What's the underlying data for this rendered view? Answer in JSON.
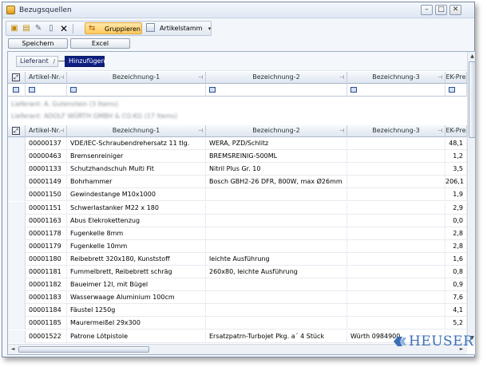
{
  "window": {
    "title": "Bezugsquellen",
    "controls": {
      "minimize": "–",
      "maximize": "□",
      "close": "✕"
    }
  },
  "toolbar": {
    "group_label": "Gruppieren",
    "article_label": "Artikelstamm",
    "overflow": "▾"
  },
  "buttons": {
    "save": "Speichern",
    "excel": "Excel"
  },
  "group_panel": {
    "chip": "Lieferant",
    "sort_glyph": "/",
    "add": "Hinzufügen"
  },
  "columns": [
    "Artikel-Nr.",
    "Bezeichnung-1",
    "Bezeichnung-2",
    "Bezeichnung-3",
    "EK-Pre"
  ],
  "filter_symbol": "▫",
  "groups": [
    "Lieferant: A. Gutenstein (3 Items)",
    "Lieferant: ADOLF WÜRTH GMBH & CO.KG (17 Items)"
  ],
  "rows": [
    {
      "nr": "00000137",
      "b1": "VDE/IEC-Schraubendrehersatz 11 tlg.",
      "b2": "WERA, PZD/Schlitz",
      "b3": "",
      "ek": "48,1"
    },
    {
      "nr": "00000463",
      "b1": "Bremsenreiniger",
      "b2": "BREMSREINIG-500ML",
      "b3": "",
      "ek": "1,2"
    },
    {
      "nr": "00001133",
      "b1": "Schutzhandschuh Multi Fit",
      "b2": "Nitril Plus Gr. 10",
      "b3": "",
      "ek": "3,5"
    },
    {
      "nr": "00001149",
      "b1": "Bohrhammer",
      "b2": "Bosch GBH2-26 DFR, 800W, max Ø26mm",
      "b3": "",
      "ek": "206,1"
    },
    {
      "nr": "00001150",
      "b1": "Gewindestange M10x1000",
      "b2": "",
      "b3": "",
      "ek": "1,9"
    },
    {
      "nr": "00001151",
      "b1": "Schwerlastanker M22 x 180",
      "b2": "",
      "b3": "",
      "ek": "2,9"
    },
    {
      "nr": "00001163",
      "b1": "Abus Elekrokettenzug",
      "b2": "",
      "b3": "",
      "ek": "0,0"
    },
    {
      "nr": "00001178",
      "b1": "Fugenkelle 8mm",
      "b2": "",
      "b3": "",
      "ek": "2,8"
    },
    {
      "nr": "00001179",
      "b1": "Fugenkelle 10mm",
      "b2": "",
      "b3": "",
      "ek": "2,8"
    },
    {
      "nr": "00001180",
      "b1": "Reibebrett 320x180, Kunststoff",
      "b2": "leichte Ausführung",
      "b3": "",
      "ek": "1,6"
    },
    {
      "nr": "00001181",
      "b1": "Fummelbrett, Reibebrett schräg",
      "b2": "260x80, leichte Ausführung",
      "b3": "",
      "ek": "0,8"
    },
    {
      "nr": "00001182",
      "b1": "Baueimer 12l, mit Bügel",
      "b2": "",
      "b3": "",
      "ek": "0,9"
    },
    {
      "nr": "00001183",
      "b1": "Wasserwaage Aluminium 100cm",
      "b2": "",
      "b3": "",
      "ek": "7,6"
    },
    {
      "nr": "00001184",
      "b1": "Fäustel 1250g",
      "b2": "",
      "b3": "",
      "ek": "4,1"
    },
    {
      "nr": "00001185",
      "b1": "Maurermeißel 29x300",
      "b2": "",
      "b3": "",
      "ek": "5,2"
    },
    {
      "nr": "00001522",
      "b1": "Patrone Lötpistole",
      "b2": "Ersatzpatrn-Turbojet Pkg. a´ 4 Stück",
      "b3": "Würth 0984900",
      "ek": ""
    }
  ],
  "scroll": {
    "up": "▲",
    "down": "▼",
    "left": "◄",
    "right": "►"
  },
  "logo": {
    "text": "HEUSER",
    "color": "#3d6fb4"
  },
  "colors": {
    "accent": "#0d1e80",
    "group_button": "#ffcb5e"
  }
}
